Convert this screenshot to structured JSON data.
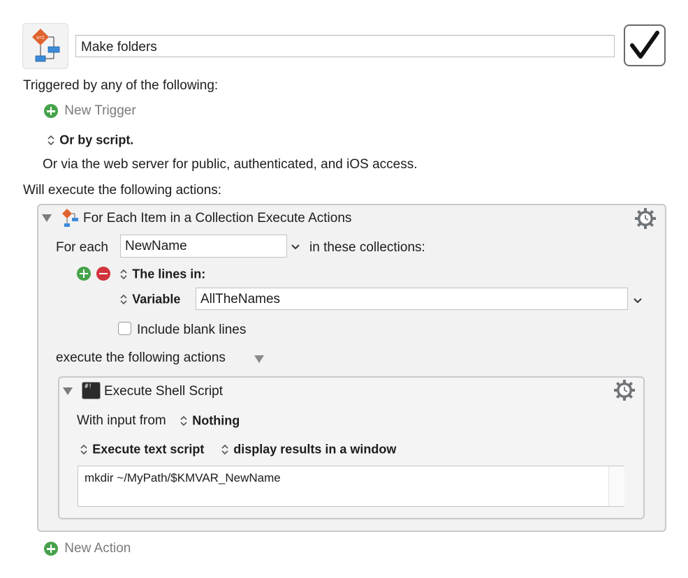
{
  "macro": {
    "name": "Make folders",
    "enabled": true
  },
  "triggers": {
    "heading": "Triggered by any of the following:",
    "new_trigger": "New Trigger",
    "script_option": "Or by script.",
    "web_note": "Or via the web server for public, authenticated, and iOS access."
  },
  "actions": {
    "heading": "Will execute the following actions:",
    "new_action": "New Action",
    "for_each": {
      "title": "For Each Item in a Collection Execute Actions",
      "for_each_label": "For each",
      "variable_name": "NewName",
      "in_collections_label": "in these collections:",
      "collection_type": "The lines in:",
      "source_type": "Variable",
      "source_value": "AllTheNames",
      "include_blank_label": "Include blank lines",
      "include_blank_checked": false,
      "execute_label": "execute the following actions"
    },
    "shell_script": {
      "title": "Execute Shell Script",
      "terminal_glyph": "#!",
      "input_label": "With input from",
      "input_value": "Nothing",
      "script_mode": "Execute text script",
      "output_mode": "display results in a window",
      "script_text": "mkdir ~/MyPath/$KMVAR_NewName"
    }
  },
  "icons": {
    "macro_icon": "flowchart-icon",
    "gear": "gear-clock-icon",
    "checkmark": "checkmark-icon"
  },
  "colors": {
    "add": "#46a24a",
    "remove": "#d2333c",
    "diamond": "#e0632f",
    "flow_box": "#3b8bd9"
  }
}
